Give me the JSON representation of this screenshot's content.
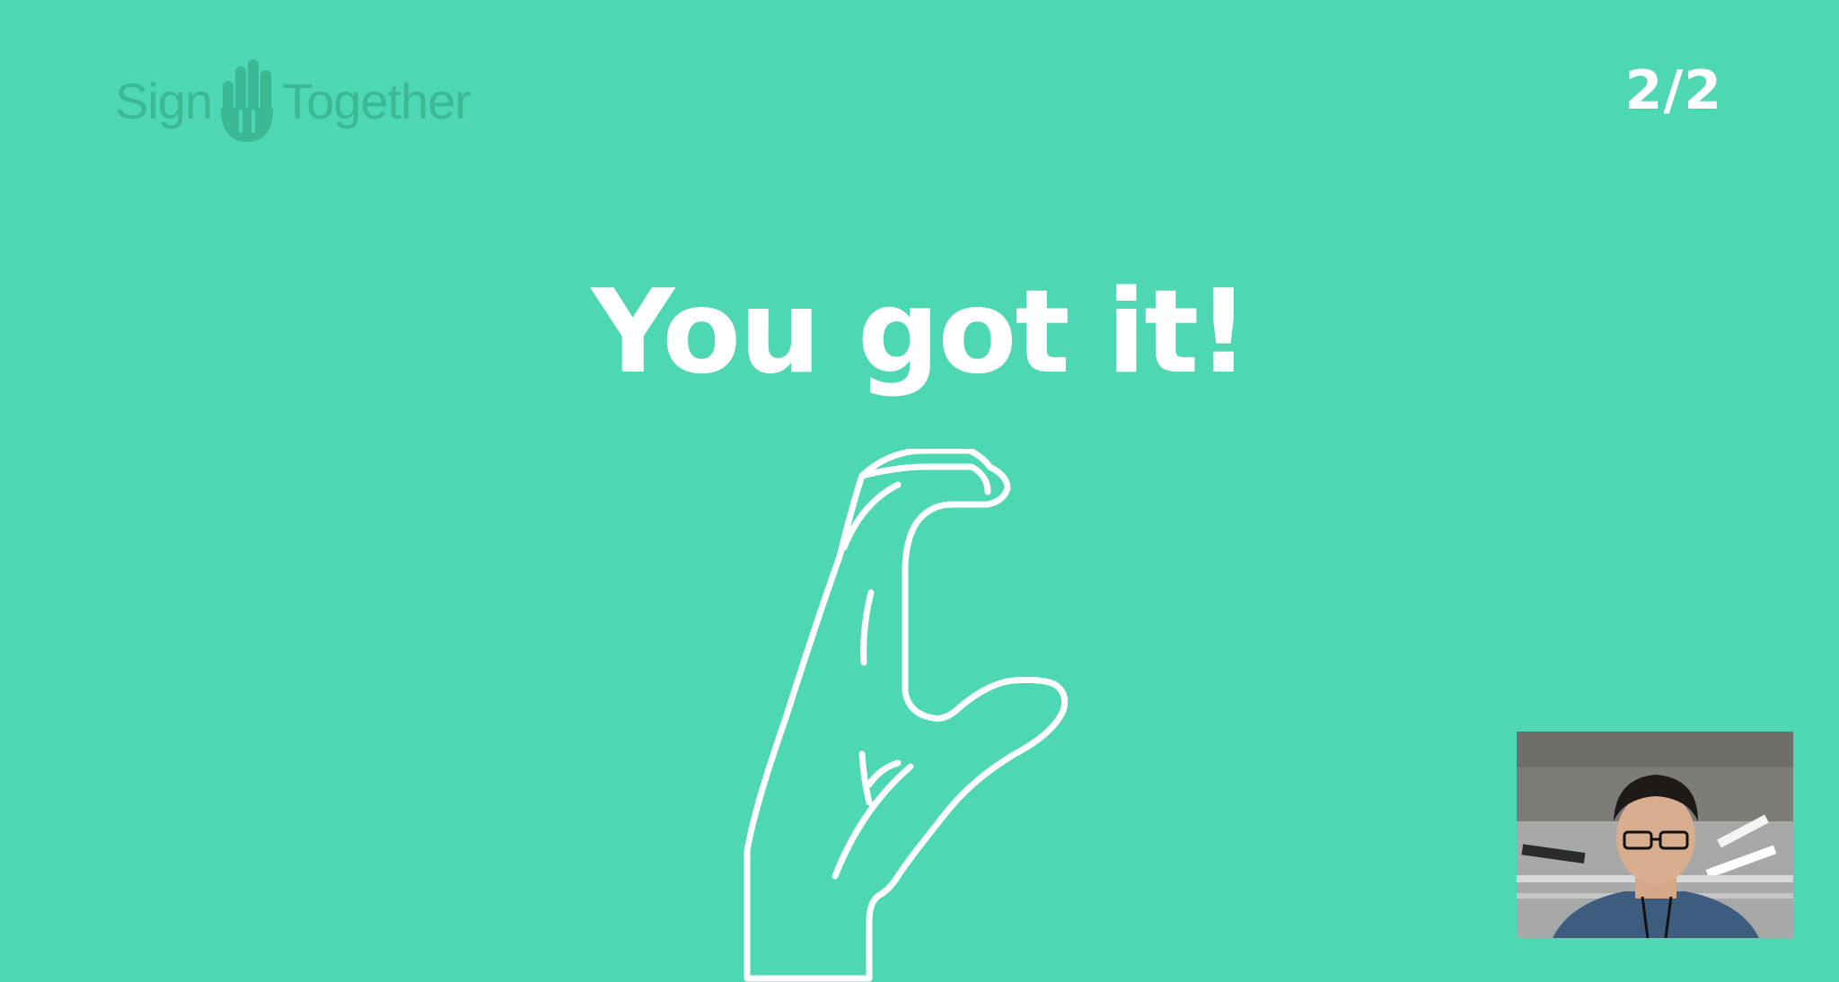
{
  "app": {
    "logo": {
      "word_left": "Sign",
      "word_right": "Together",
      "icon": "raised-hand-icon",
      "color": "#3bb995"
    },
    "progress_label": "2/2",
    "background_color": "#4dd7b2"
  },
  "main": {
    "title": "You got it!",
    "illustration_icon": "asl-c-handshape-icon",
    "illustration_color": "#ffffff"
  },
  "camera_preview": {
    "icon": "webcam-feed"
  }
}
